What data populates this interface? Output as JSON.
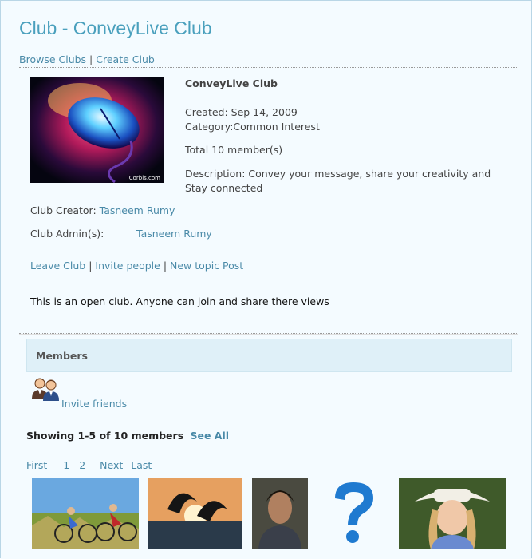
{
  "page": {
    "title": "Club - ConveyLive Club"
  },
  "topnav": {
    "browse": "Browse Clubs",
    "separator": "|",
    "create": "Create Club"
  },
  "club": {
    "image_caption": "Corbis.com",
    "name": "ConveyLive Club",
    "created": "Created: Sep 14, 2009",
    "category_label": "Category:",
    "category_value": "Common Interest",
    "members_total": "Total 10 member(s)",
    "description": "Description: Convey your message, share your creativity and Stay connected",
    "creator_label": "Club Creator:",
    "creator_name": "Tasneem Rumy",
    "admin_label": "Club Admin(s):",
    "admin_name": "Tasneem Rumy"
  },
  "actions": {
    "leave": "Leave Club",
    "invite": "Invite people",
    "new_topic": "New topic Post",
    "separator": "|"
  },
  "open_text": "This is an open club. Anyone can join and share there views",
  "members": {
    "title": "Members",
    "invite_friends": "Invite friends",
    "showing": "Showing 1-5 of 10 members",
    "see_all": "See All",
    "pager": {
      "first": "First",
      "page1": "1",
      "page2": "2",
      "next": "Next",
      "last": "Last"
    },
    "photos": [
      "cyclists-photo",
      "dolphins-photo",
      "man-portrait-photo",
      "question-mark-avatar",
      "cowgirl-portrait-photo"
    ]
  },
  "colors": {
    "link": "#4a8aa8",
    "title": "#4aa0bd",
    "members_bar": "#dff0f8",
    "background": "#f4fbff"
  }
}
